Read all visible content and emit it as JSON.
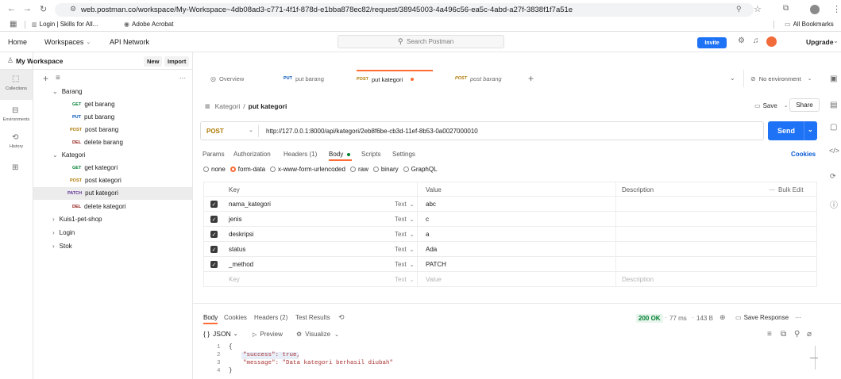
{
  "browser": {
    "url": "web.postman.co/workspace/My-Workspace~4db08ad3-c771-4f1f-878d-e1bba878ec82/request/38945003-4a496c56-ea5c-4abd-a27f-3838f1f7a51e",
    "bookmarks": [
      "Login | Skills for All...",
      "Adobe Acrobat"
    ],
    "all_bookmarks": "All Bookmarks"
  },
  "header": {
    "nav": [
      "Home",
      "Workspaces",
      "API Network"
    ],
    "search_placeholder": "Search Postman",
    "invite": "Invite",
    "upgrade": "Upgrade"
  },
  "workspace": {
    "name": "My Workspace",
    "new": "New",
    "import": "Import"
  },
  "rail": {
    "collections": "Collections",
    "environments": "Environments",
    "history": "History"
  },
  "tree": [
    {
      "kind": "folder",
      "label": "Barang",
      "open": true
    },
    {
      "kind": "req",
      "method": "GET",
      "label": "get barang"
    },
    {
      "kind": "req",
      "method": "PUT",
      "label": "put barang"
    },
    {
      "kind": "req",
      "method": "POST",
      "label": "post barang"
    },
    {
      "kind": "req",
      "method": "DEL",
      "label": "delete barang"
    },
    {
      "kind": "folder",
      "label": "Kategori",
      "open": true
    },
    {
      "kind": "req",
      "method": "GET",
      "label": "get kategori"
    },
    {
      "kind": "req",
      "method": "POST",
      "label": "post kategori"
    },
    {
      "kind": "req",
      "method": "PATCH",
      "label": "put kategori",
      "active": true
    },
    {
      "kind": "req",
      "method": "DEL",
      "label": "delete kategori"
    },
    {
      "kind": "folder",
      "label": "Kuis1-pet-shop",
      "open": false
    },
    {
      "kind": "folder",
      "label": "Login",
      "open": false
    },
    {
      "kind": "folder",
      "label": "Stok",
      "open": false
    }
  ],
  "tabs": [
    {
      "method": "",
      "label": "Overview"
    },
    {
      "method": "PUT",
      "label": "put barang"
    },
    {
      "method": "POST",
      "label": "put kategori",
      "active": true
    },
    {
      "method": "POST",
      "label": "post barang"
    }
  ],
  "environment": "No environment",
  "request": {
    "breadcrumb_parent": "Kategori",
    "breadcrumb_current": "put kategori",
    "save": "Save",
    "share": "Share",
    "method": "POST",
    "url": "http://127.0.0.1:8000/api/kategori/2eb8f6be-cb3d-11ef-8b53-0a0027000010",
    "send": "Send",
    "subtabs": [
      "Params",
      "Authorization",
      "Headers (1)",
      "Body",
      "Scripts",
      "Settings"
    ],
    "cookies": "Cookies",
    "body_types": [
      "none",
      "form-data",
      "x-www-form-urlencoded",
      "raw",
      "binary",
      "GraphQL"
    ],
    "columns": [
      "Key",
      "Value",
      "Description"
    ],
    "bulk_edit": "Bulk Edit",
    "rows": [
      {
        "key": "nama_kategori",
        "type": "Text",
        "value": "abc"
      },
      {
        "key": "jenis",
        "type": "Text",
        "value": "c"
      },
      {
        "key": "deskripsi",
        "type": "Text",
        "value": "a"
      },
      {
        "key": "status",
        "type": "Text",
        "value": "Ada"
      },
      {
        "key": "_method",
        "type": "Text",
        "value": "PATCH"
      }
    ],
    "placeholder_row": {
      "key": "Key",
      "type": "Text",
      "value": "Value",
      "desc": "Description"
    }
  },
  "response": {
    "tabs": [
      "Body",
      "Cookies",
      "Headers (2)",
      "Test Results"
    ],
    "status": "200 OK",
    "time": "77 ms",
    "size": "143 B",
    "save_response": "Save Response",
    "format": "JSON",
    "preview": "Preview",
    "visualize": "Visualize",
    "lines": [
      "{",
      "\"success\": true,",
      "\"message\": \"Data kategori berhasil diubah\"",
      "}"
    ]
  }
}
